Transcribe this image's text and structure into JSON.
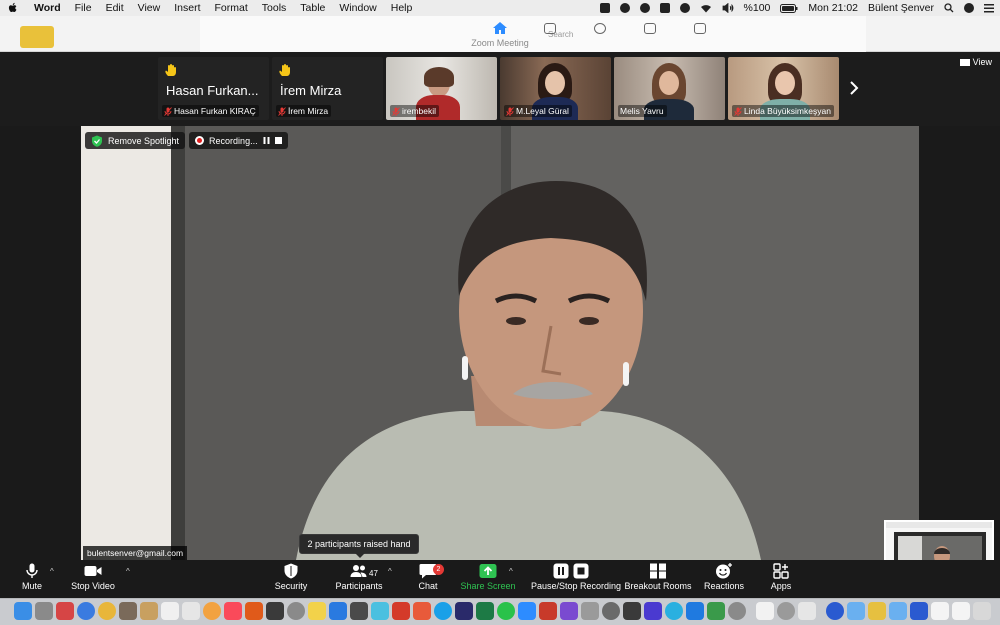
{
  "menubar": {
    "app_name": "Word",
    "items": [
      "File",
      "Edit",
      "View",
      "Insert",
      "Format",
      "Tools",
      "Table",
      "Window",
      "Help"
    ],
    "battery": "%100",
    "clock": "Mon 21:02",
    "user": "Bülent Şenver"
  },
  "titlebar": {
    "title": "Zoom Meeting",
    "search_partial": "Search"
  },
  "strip": {
    "view_label": "View",
    "participants": [
      {
        "big_name": "Hasan Furkan...",
        "name": "Hasan Furkan KIRAÇ",
        "raised_hand": true,
        "video": false
      },
      {
        "big_name": "İrem Mirza",
        "name": "İrem Mirza",
        "raised_hand": true,
        "video": false
      },
      {
        "name": "irembekil",
        "video": true
      },
      {
        "name": "M.Leyal Güral",
        "video": true
      },
      {
        "name": "Melis Yavru",
        "video": true
      },
      {
        "name": "Linda Büyüksimkeşyan",
        "video": true
      }
    ]
  },
  "main": {
    "remove_spotlight": "Remove Spotlight",
    "recording": "Recording...",
    "speaker_email": "bulentsenver@gmail.com"
  },
  "tooltip": {
    "text": "2 participants raised hand"
  },
  "toolbar": {
    "mute": "Mute",
    "stop_video": "Stop Video",
    "security": "Security",
    "participants": "Participants",
    "participants_count": "47",
    "chat": "Chat",
    "chat_badge": "2",
    "share_screen": "Share Screen",
    "pause_recording": "Pause/Stop Recording",
    "breakout_rooms": "Breakout Rooms",
    "reactions": "Reactions",
    "apps": "Apps"
  },
  "colors": {
    "share_green": "#2fc352",
    "badge_red": "#e53935",
    "mic_off_red": "#e53935",
    "zoom_blue": "#2d8cff"
  }
}
